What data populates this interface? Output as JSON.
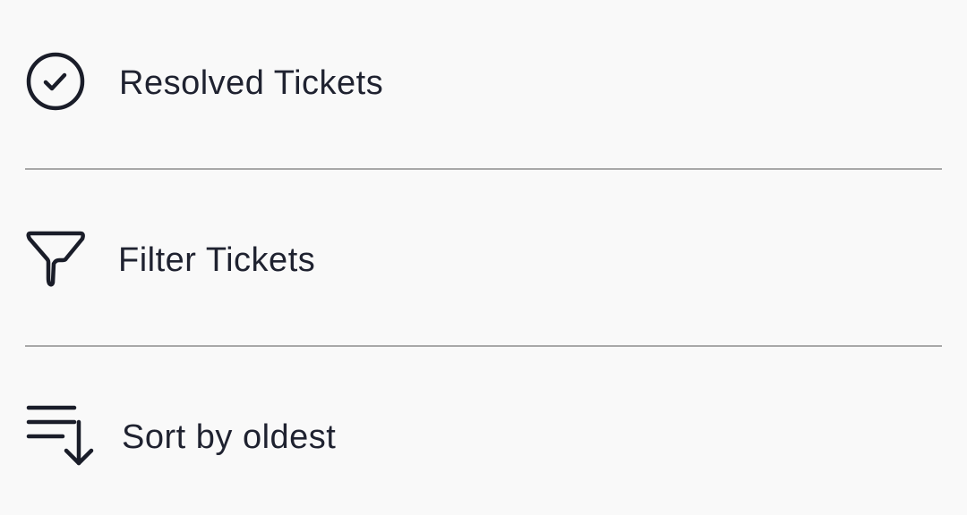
{
  "menu": {
    "items": [
      {
        "label": "Resolved Tickets",
        "icon": "check-circle-icon"
      },
      {
        "label": "Filter Tickets",
        "icon": "filter-icon"
      },
      {
        "label": "Sort by oldest",
        "icon": "sort-descending-icon"
      }
    ]
  },
  "colors": {
    "background": "#f9f9f9",
    "icon_stroke": "#1a1d29",
    "text": "#1f2230",
    "divider": "#a8a8a8"
  }
}
